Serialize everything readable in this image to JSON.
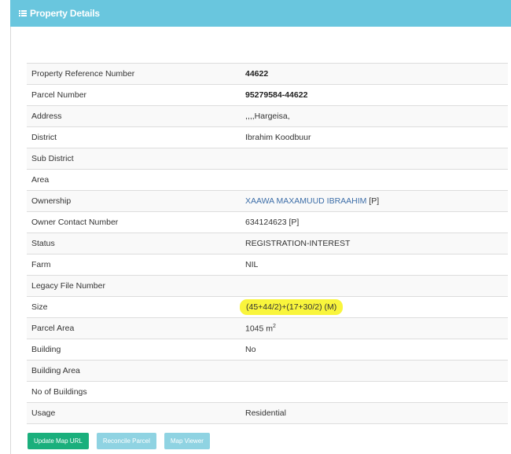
{
  "panel": {
    "title": "Property Details",
    "icon": "list-icon"
  },
  "details": [
    {
      "label": "Property Reference Number",
      "value": "44622",
      "style": "link"
    },
    {
      "label": "Parcel Number",
      "value": "95279584-44622",
      "style": "bold"
    },
    {
      "label": "Address",
      "value": ",,,,Hargeisa,"
    },
    {
      "label": "District",
      "value": "Ibrahim Koodbuur"
    },
    {
      "label": "Sub District",
      "value": ""
    },
    {
      "label": "Area",
      "value": ""
    },
    {
      "label": "Ownership",
      "value": "XAAWA MAXAMUUD IBRAAHIM",
      "suffix": " [P]",
      "style": "link"
    },
    {
      "label": "Owner Contact Number",
      "value": "634124623 [P]"
    },
    {
      "label": "Status",
      "value": "REGISTRATION-INTEREST"
    },
    {
      "label": "Farm",
      "value": "NIL"
    },
    {
      "label": "Legacy File Number",
      "value": ""
    },
    {
      "label": "Size",
      "value": "(45+44/2)+(17+30/2) (M)",
      "style": "highlight"
    },
    {
      "label": "Parcel Area",
      "value": "1045 m",
      "unit_sup": "2"
    },
    {
      "label": "Building",
      "value": "No"
    },
    {
      "label": "Building Area",
      "value": ""
    },
    {
      "label": "No of Buildings",
      "value": ""
    },
    {
      "label": "Usage",
      "value": "Residential"
    }
  ],
  "buttons": {
    "update_map_url": "Update Map URL",
    "reconcile_parcel": "Reconcile Parcel",
    "map_viewer": "Map Viewer"
  },
  "colors": {
    "header": "#69c6de",
    "link": "#3d6ea8",
    "highlight": "#f9f53c",
    "button_green": "#1aaf7c",
    "button_blue": "#8fd3e2"
  }
}
